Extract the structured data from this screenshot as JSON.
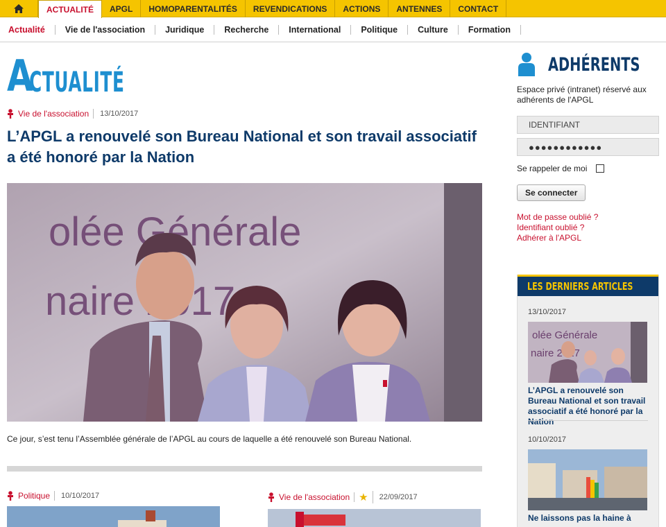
{
  "topnav": {
    "home_icon": "home-icon",
    "items": [
      "ACTUALITÉ",
      "APGL",
      "HOMOPARENTALITÉS",
      "REVENDICATIONS",
      "ACTIONS",
      "ANTENNES",
      "CONTACT"
    ],
    "active_index": 0,
    "colors": {
      "bar": "#f5c400",
      "active_text": "#c8102e"
    }
  },
  "subnav": {
    "items": [
      "Actualité",
      "Vie de l'association",
      "Juridique",
      "Recherche",
      "International",
      "Politique",
      "Culture",
      "Formation"
    ],
    "active_index": 0
  },
  "page": {
    "title_initial": "A",
    "title_rest": "CTUALITÉ",
    "title_color": "#1e8fd0"
  },
  "article": {
    "category": "Vie de l'association",
    "date": "13/10/2017",
    "title": "L’APGL a renouvelé son Bureau National et son travail associatif a été honoré par la Nation",
    "excerpt": "Ce jour, s’est tenu l’Assemblée générale de l’APGL au cours de laquelle a été renouvelé son Bureau National.",
    "image_text": [
      "olée Générale",
      "naire 2017"
    ]
  },
  "cards": [
    {
      "category": "Politique",
      "date": "10/10/2017",
      "starred": false
    },
    {
      "category": "Vie de l'association",
      "date": "22/09/2017",
      "starred": true
    }
  ],
  "members": {
    "heading": "ADHÉRENTS",
    "description": "Espace privé (intranet) réservé aux adhérents de l'APGL",
    "username_placeholder": "IDENTIFIANT",
    "password_value": "●●●●●●●●●●●●",
    "remember_label": "Se rappeler de moi",
    "remember_checked": false,
    "connect_label": "Se connecter",
    "links": [
      "Mot de passe oublié ?",
      "Identifiant oublié ?",
      "Adhérer à l'APGL"
    ]
  },
  "latest": {
    "heading": "LES DERNIERS ARTICLES",
    "items": [
      {
        "date": "13/10/2017",
        "title": "L’APGL a renouvelé son Bureau National et son travail associatif a été honoré par la Nation"
      },
      {
        "date": "10/10/2017",
        "title": "Ne laissons pas la haine à"
      }
    ]
  }
}
